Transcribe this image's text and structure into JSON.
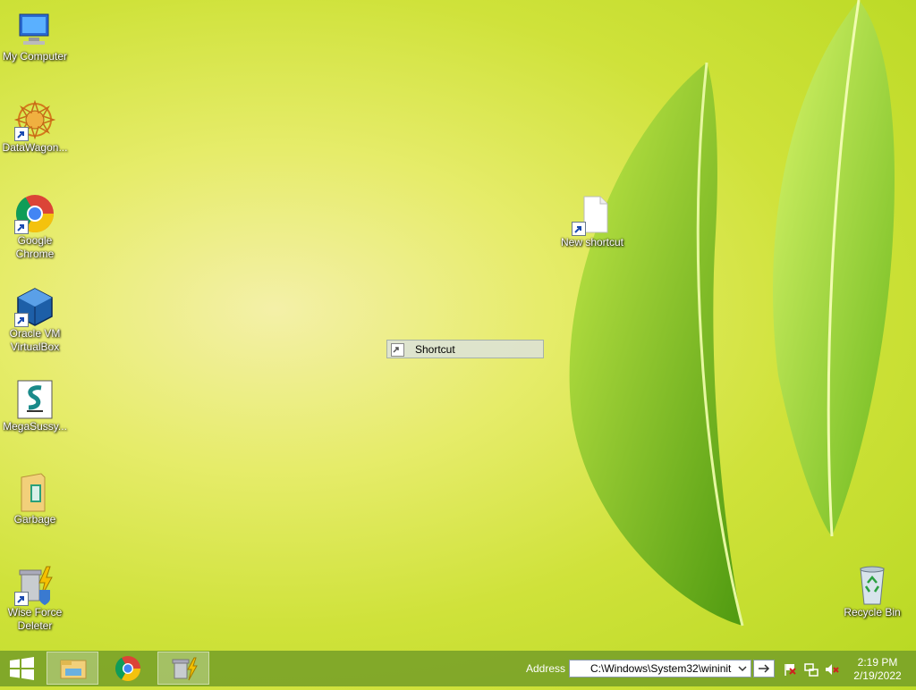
{
  "desktop": {
    "icons": [
      {
        "label": "My Computer"
      },
      {
        "label": "DataWagon..."
      },
      {
        "label": "Google Chrome"
      },
      {
        "label": "Oracle VM VirtualBox"
      },
      {
        "label": "MegaSussy..."
      },
      {
        "label": "Garbage"
      },
      {
        "label": "Wise Force Deleter"
      },
      {
        "label": "New shortcut"
      },
      {
        "label": "Recycle Bin"
      }
    ],
    "context_item": {
      "label": "Shortcut"
    }
  },
  "taskbar": {
    "address_label": "Address",
    "address_value": "C:\\Windows\\System32\\wininit",
    "clock_time": "2:19 PM",
    "clock_date": "2/19/2022"
  },
  "colors": {
    "taskbar": "#78a028",
    "wallpaper": "#cfe23a",
    "leaf": "#6fb51c"
  }
}
